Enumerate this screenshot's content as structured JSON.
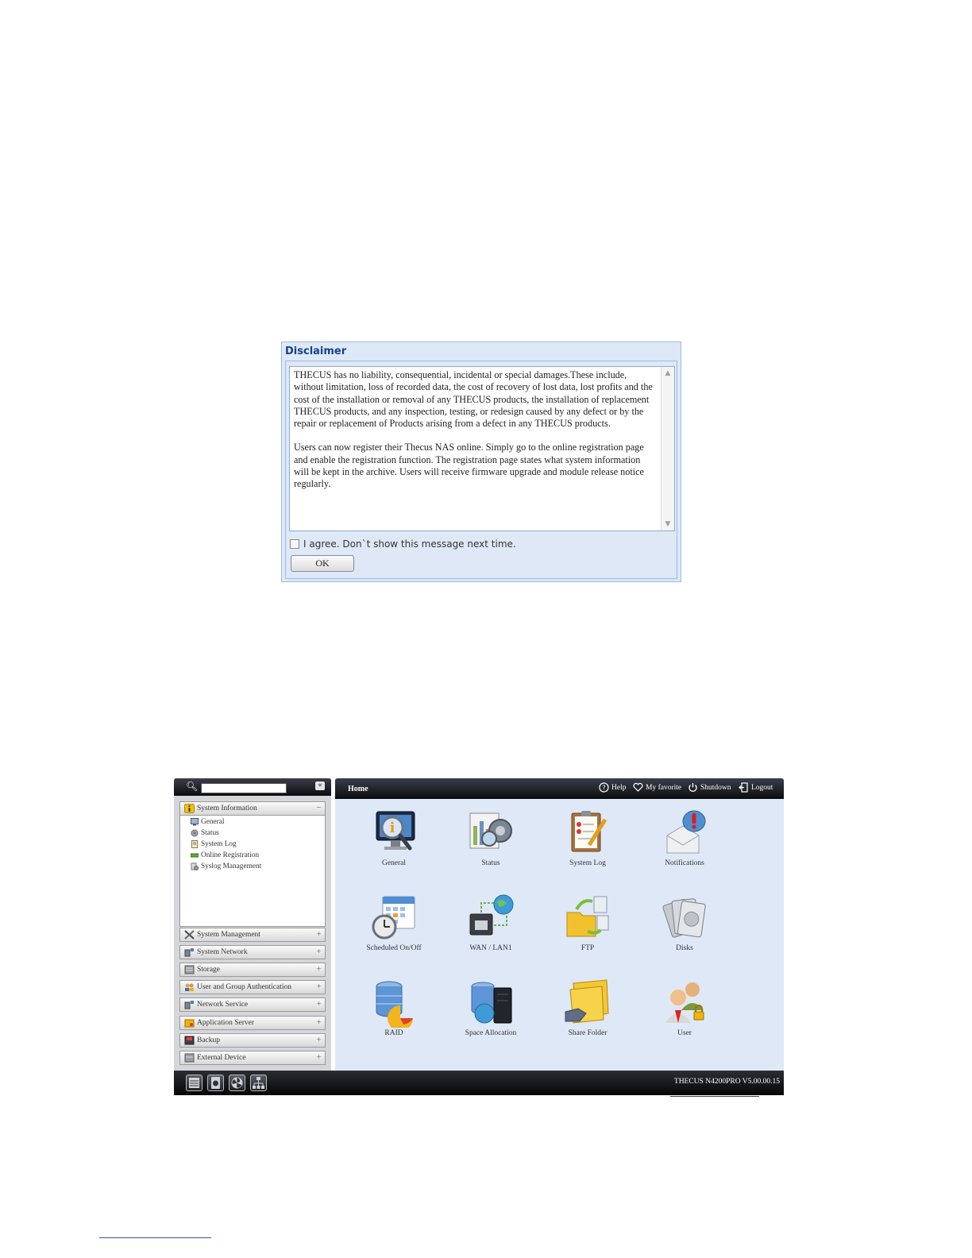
{
  "disclaimer": {
    "title": "Disclaimer",
    "paragraph1": "THECUS has no liability, consequential, incidental or special damages.These include, without limitation, loss of recorded data, the cost of recovery of lost data, lost profits and the cost of the installation or removal of any THECUS products, the installation of replacement THECUS products, and any inspection, testing, or redesign caused by any defect or by the repair or replacement of Products arising from a defect in any THECUS products.",
    "paragraph2": "Users can now register their Thecus NAS online. Simply go to the online registration page and enable the registration function. The registration page states what system information will be kept in the archive. Users will receive firmware upgrade and module release notice regularly.",
    "agree_label": "I agree. Don`t show this message next time.",
    "ok_label": "OK"
  },
  "sidebar": {
    "search_placeholder": "",
    "collapse_glyph": "«",
    "system_information": {
      "label": "System Information",
      "toggle": "−",
      "items": [
        "General",
        "Status",
        "System Log",
        "Online Registration",
        "Syslog Management"
      ]
    },
    "sections": [
      {
        "label": "System Management",
        "icon": "tools-icon"
      },
      {
        "label": "System Network",
        "icon": "network-icon"
      },
      {
        "label": "Storage",
        "icon": "storage-icon"
      },
      {
        "label": "User and Group Authentication",
        "icon": "users-icon"
      },
      {
        "label": "Network Service",
        "icon": "network-service-icon"
      },
      {
        "label": "Application Server",
        "icon": "application-server-icon"
      },
      {
        "label": "Backup",
        "icon": "backup-icon"
      },
      {
        "label": "External Device",
        "icon": "external-device-icon"
      }
    ],
    "expand_glyph": "+"
  },
  "content": {
    "title": "Home",
    "toolbar": {
      "help": "Help",
      "favorite": "My favorite",
      "shutdown": "Shutdown",
      "logout": "Logout"
    },
    "apps": [
      {
        "label": "General",
        "icon": "general-icon"
      },
      {
        "label": "Status",
        "icon": "status-icon"
      },
      {
        "label": "System Log",
        "icon": "system-log-icon"
      },
      {
        "label": "Notifications",
        "icon": "notifications-icon"
      },
      {
        "label": "Scheduled On/Off",
        "icon": "scheduled-icon"
      },
      {
        "label": "WAN / LAN1",
        "icon": "wan-lan-icon"
      },
      {
        "label": "FTP",
        "icon": "ftp-icon"
      },
      {
        "label": "Disks",
        "icon": "disks-icon"
      },
      {
        "label": "RAID",
        "icon": "raid-icon"
      },
      {
        "label": "Space Allocation",
        "icon": "space-allocation-icon"
      },
      {
        "label": "Share Folder",
        "icon": "share-folder-icon"
      },
      {
        "label": "User",
        "icon": "user-icon"
      }
    ]
  },
  "footer": {
    "version": "THECUS N4200PRO V5.00.00.15",
    "buttons": [
      "server-icon",
      "disk-icon",
      "fan-icon",
      "network-tree-icon"
    ]
  },
  "colors": {
    "dialog_bg": "#dfe8f6",
    "dialog_title": "#15428b",
    "dark_bar": "#0b0c10"
  }
}
